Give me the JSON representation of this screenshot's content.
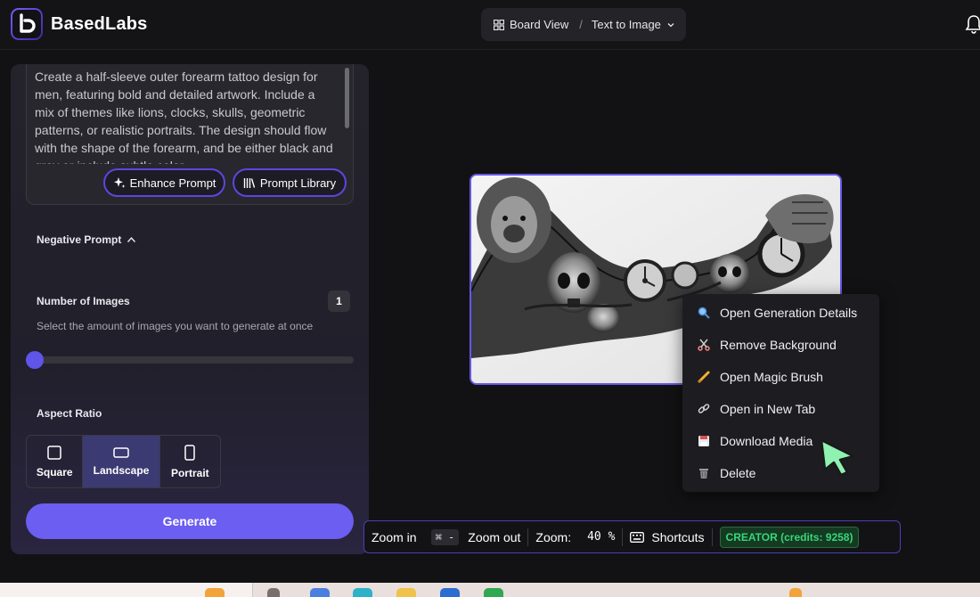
{
  "app": {
    "brand_name": "BasedLabs",
    "logo_letter": "b"
  },
  "breadcrumb": {
    "board_view_label": "Board View",
    "separator": "/",
    "current_label": "Text to Image"
  },
  "prompt": {
    "text": "Create a half-sleeve outer forearm tattoo design for men, featuring bold and detailed artwork. Include a mix of themes like lions, clocks, skulls, geometric patterns, or realistic portraits. The design should flow with the shape of the forearm, and be either black and grey or include subtle color",
    "enhance_label": "Enhance Prompt",
    "library_label": "Prompt Library"
  },
  "negative_prompt": {
    "label": "Negative Prompt"
  },
  "number_of_images": {
    "label": "Number of Images",
    "helper": "Select the amount of images you want to generate at once",
    "value": "1",
    "slider_fraction": 0.0
  },
  "aspect_ratio": {
    "label": "Aspect Ratio",
    "options": [
      "Square",
      "Landscape",
      "Portrait"
    ],
    "selected": "Landscape"
  },
  "generate_label": "Generate",
  "context_menu": {
    "items": [
      {
        "label": "Open Generation Details",
        "icon": "magnifier-icon"
      },
      {
        "label": "Remove Background",
        "icon": "scissors-icon"
      },
      {
        "label": "Open Magic Brush",
        "icon": "brush-icon"
      },
      {
        "label": "Open in New Tab",
        "icon": "link-icon"
      },
      {
        "label": "Download Media",
        "icon": "floppy-disk-icon"
      },
      {
        "label": "Delete",
        "icon": "trash-icon"
      }
    ]
  },
  "zoom_bar": {
    "zoom_in_label": "Zoom in",
    "zoom_out_key": "⌘ -",
    "zoom_out_label": "Zoom out",
    "zoom_label": "Zoom:",
    "zoom_value": "40 %",
    "shortcuts_label": "Shortcuts",
    "plan_badge": "CREATOR (credits: 9258)"
  },
  "colors": {
    "accent": "#6b5ef0",
    "selected_border": "#6557e6",
    "badge_green": "#37d67a"
  }
}
